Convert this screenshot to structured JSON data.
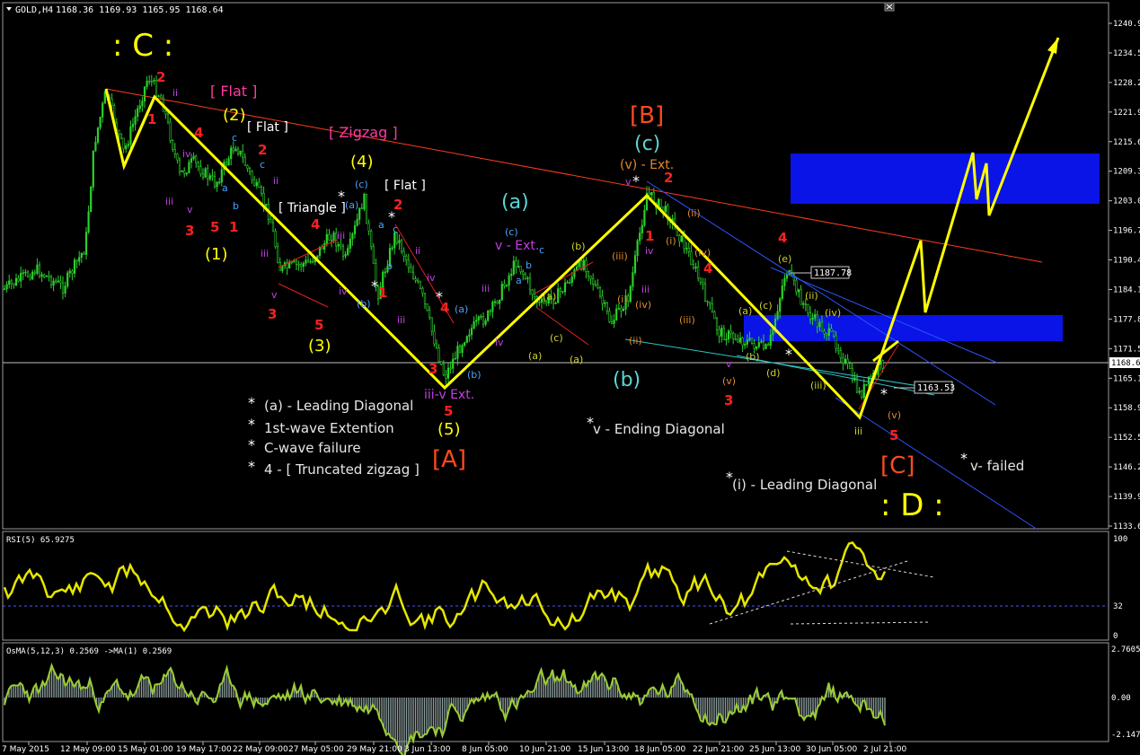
{
  "window": {
    "symbol_title": "GOLD,H4",
    "ohlc": "1168.36 1169.93 1165.95 1168.64",
    "close_icon": "close-icon"
  },
  "main_price_scale": [
    "1240.93",
    "1234.55",
    "1228.27",
    "1221.90",
    "1215.61",
    "1209.34",
    "1203.09",
    "1196.70",
    "1190.45",
    "1184.17",
    "1177.83",
    "1171.56",
    "1165.18",
    "1158.92",
    "1152.55",
    "1146.28",
    "1139.96",
    "1133.62"
  ],
  "current_price": "1168.64",
  "rsi": {
    "label": "RSI(5) 65.9275",
    "scale": [
      "100",
      "32",
      "0"
    ],
    "level_dotted": 32
  },
  "osma": {
    "label": "OsMA(5,12,3) 0.2569 ->MA(1) 0.2569",
    "scale": [
      "2.7605",
      "0.00",
      "-2.1471"
    ]
  },
  "time_axis": [
    "7 May 2015",
    "12 May 09:00",
    "15 May 01:00",
    "19 May 17:00",
    "22 May 09:00",
    "27 May 05:00",
    "29 May 21:00",
    "3 Jun 13:00",
    "8 Jun 05:00",
    "10 Jun 21:00",
    "15 Jun 13:00",
    "18 Jun 05:00",
    "22 Jun 21:00",
    "25 Jun 13:00",
    "30 Jun 05:00",
    "2 Jul 21:00"
  ],
  "annotations": {
    "big_c": ": C :",
    "big_d": ": D :",
    "wave_A": "[A]",
    "wave_B": "[B]",
    "wave_C": "[C]",
    "wave_c_b": "(c)",
    "wave_a": "(a)",
    "wave_b": "(b)",
    "w1": "(1)",
    "w2": "(2)",
    "w3": "(3)",
    "w4": "(4)",
    "w5": "(5)",
    "flat1": "[ Flat ]",
    "flat2": "[ Flat ]",
    "flat3": "[ Flat ]",
    "zigzag": "[ Zigzag ]",
    "triangle": "[ Triangle ]",
    "v_ext_top": "(v) - Ext.",
    "v_ext_mid": "v - Ext.",
    "iii_v_ext": "iii-v Ext.",
    "notes": [
      "(a) - Leading Diagonal",
      "1st-wave Extention",
      "C-wave failure",
      "4 - [ Truncated zigzag ]"
    ],
    "ending_diagonal": "v - Ending Diagonal",
    "leading_diagonal": "(i) - Leading Diagonal",
    "v_failed": "v- failed",
    "price_tag_1": "1187.78",
    "price_tag_2": "1163.53"
  },
  "colors": {
    "candle_up": "#2bd12b",
    "zigzag_line": "#ffff00",
    "trend_red": "#ff3c1e",
    "channel_blue": "#2b55ff",
    "target_box": "#0a14e6",
    "rsi_line": "#e6e600"
  },
  "chart_data": [
    {
      "type": "line",
      "title": "GOLD,H4",
      "series": [
        {
          "name": "Elliott wave path",
          "points": [
            {
              "x": "7 May 2015",
              "y": 1228.5
            },
            {
              "x": "12 May 09:00",
              "y": 1210.0
            },
            {
              "x": "15 May 01:00",
              "y": 1226.0
            },
            {
              "x": "3 Jun 13:00",
              "y": 1163.0
            },
            {
              "x": "18 Jun 05:00",
              "y": 1205.0
            },
            {
              "x": "2 Jul 21:00",
              "y": 1157.5
            },
            {
              "x": "after 2 Jul",
              "y": 1196.0
            },
            {
              "x": "after 2 Jul",
              "y": 1180.0
            },
            {
              "x": "after 2 Jul",
              "y": 1211.0
            },
            {
              "x": "after 2 Jul",
              "y": 1205.0
            },
            {
              "x": "after 2 Jul",
              "y": 1210.0
            },
            {
              "x": "after 2 Jul",
              "y": 1203.0
            },
            {
              "x": "after 2 Jul",
              "y": 1238.0
            }
          ]
        }
      ],
      "target_zones": [
        {
          "from": 1203.0,
          "to": 1212.5
        },
        {
          "from": 1173.5,
          "to": 1179.0
        }
      ],
      "ylim": [
        1133.62,
        1240.93
      ]
    },
    {
      "type": "line",
      "title": "RSI(5) 65.9275",
      "ylim": [
        0,
        100
      ],
      "last": 65.93,
      "level": 32
    },
    {
      "type": "bar",
      "title": "OsMA(5,12,3) 0.2569 ->MA(1) 0.2569",
      "ylim": [
        -2.1471,
        2.7605
      ],
      "last": 0.2569
    }
  ]
}
